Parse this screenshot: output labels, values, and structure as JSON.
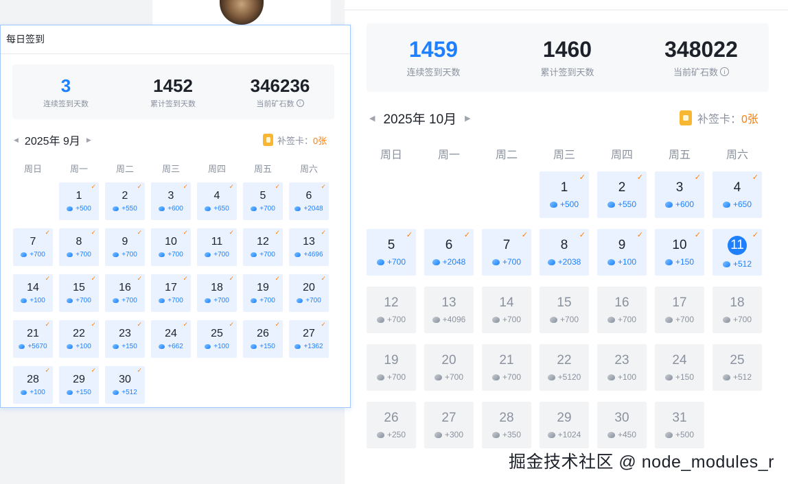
{
  "popup": {
    "title": "每日签到",
    "stats": [
      {
        "value": "3",
        "label": "连续签到天数",
        "highlight": true
      },
      {
        "value": "1452",
        "label": "累计签到天数",
        "highlight": false
      },
      {
        "value": "346236",
        "label": "当前矿石数",
        "highlight": false,
        "info": true
      }
    ],
    "month": "2025年 9月",
    "card_label": "补签卡：",
    "card_count": "0张",
    "weekdays": [
      "周日",
      "周一",
      "周二",
      "周三",
      "周四",
      "周五",
      "周六"
    ],
    "leading_empty": 1,
    "days": [
      {
        "d": "1",
        "p": "+500",
        "s": "done"
      },
      {
        "d": "2",
        "p": "+550",
        "s": "done"
      },
      {
        "d": "3",
        "p": "+600",
        "s": "done"
      },
      {
        "d": "4",
        "p": "+650",
        "s": "done"
      },
      {
        "d": "5",
        "p": "+700",
        "s": "done"
      },
      {
        "d": "6",
        "p": "+2048",
        "s": "done"
      },
      {
        "d": "7",
        "p": "+700",
        "s": "done"
      },
      {
        "d": "8",
        "p": "+700",
        "s": "done"
      },
      {
        "d": "9",
        "p": "+700",
        "s": "done"
      },
      {
        "d": "10",
        "p": "+700",
        "s": "done"
      },
      {
        "d": "11",
        "p": "+700",
        "s": "done"
      },
      {
        "d": "12",
        "p": "+700",
        "s": "done"
      },
      {
        "d": "13",
        "p": "+4696",
        "s": "done"
      },
      {
        "d": "14",
        "p": "+100",
        "s": "done"
      },
      {
        "d": "15",
        "p": "+700",
        "s": "done"
      },
      {
        "d": "16",
        "p": "+700",
        "s": "done"
      },
      {
        "d": "17",
        "p": "+700",
        "s": "done"
      },
      {
        "d": "18",
        "p": "+700",
        "s": "done"
      },
      {
        "d": "19",
        "p": "+700",
        "s": "done"
      },
      {
        "d": "20",
        "p": "+700",
        "s": "done"
      },
      {
        "d": "21",
        "p": "+5670",
        "s": "done"
      },
      {
        "d": "22",
        "p": "+100",
        "s": "done"
      },
      {
        "d": "23",
        "p": "+150",
        "s": "done"
      },
      {
        "d": "24",
        "p": "+662",
        "s": "done"
      },
      {
        "d": "25",
        "p": "+100",
        "s": "done"
      },
      {
        "d": "26",
        "p": "+150",
        "s": "done"
      },
      {
        "d": "27",
        "p": "+1362",
        "s": "done"
      },
      {
        "d": "28",
        "p": "+100",
        "s": "done"
      },
      {
        "d": "29",
        "p": "+150",
        "s": "done"
      },
      {
        "d": "30",
        "p": "+512",
        "s": "done"
      }
    ]
  },
  "main": {
    "stats": [
      {
        "value": "1459",
        "label": "连续签到天数",
        "highlight": true
      },
      {
        "value": "1460",
        "label": "累计签到天数",
        "highlight": false
      },
      {
        "value": "348022",
        "label": "当前矿石数",
        "highlight": false,
        "info": true
      }
    ],
    "month": "2025年 10月",
    "card_label": "补签卡：",
    "card_count": "0张",
    "weekdays": [
      "周日",
      "周一",
      "周二",
      "周三",
      "周四",
      "周五",
      "周六"
    ],
    "leading_empty": 3,
    "days": [
      {
        "d": "1",
        "p": "+500",
        "s": "done"
      },
      {
        "d": "2",
        "p": "+550",
        "s": "done"
      },
      {
        "d": "3",
        "p": "+600",
        "s": "done"
      },
      {
        "d": "4",
        "p": "+650",
        "s": "done"
      },
      {
        "d": "5",
        "p": "+700",
        "s": "done"
      },
      {
        "d": "6",
        "p": "+2048",
        "s": "done"
      },
      {
        "d": "7",
        "p": "+700",
        "s": "done"
      },
      {
        "d": "8",
        "p": "+2038",
        "s": "done"
      },
      {
        "d": "9",
        "p": "+100",
        "s": "done"
      },
      {
        "d": "10",
        "p": "+150",
        "s": "done"
      },
      {
        "d": "11",
        "p": "+512",
        "s": "today"
      },
      {
        "d": "12",
        "p": "+700",
        "s": "future"
      },
      {
        "d": "13",
        "p": "+4096",
        "s": "future"
      },
      {
        "d": "14",
        "p": "+700",
        "s": "future"
      },
      {
        "d": "15",
        "p": "+700",
        "s": "future"
      },
      {
        "d": "16",
        "p": "+700",
        "s": "future"
      },
      {
        "d": "17",
        "p": "+700",
        "s": "future"
      },
      {
        "d": "18",
        "p": "+700",
        "s": "future"
      },
      {
        "d": "19",
        "p": "+700",
        "s": "future"
      },
      {
        "d": "20",
        "p": "+700",
        "s": "future"
      },
      {
        "d": "21",
        "p": "+700",
        "s": "future"
      },
      {
        "d": "22",
        "p": "+5120",
        "s": "future"
      },
      {
        "d": "23",
        "p": "+100",
        "s": "future"
      },
      {
        "d": "24",
        "p": "+150",
        "s": "future"
      },
      {
        "d": "25",
        "p": "+512",
        "s": "future"
      },
      {
        "d": "26",
        "p": "+250",
        "s": "future"
      },
      {
        "d": "27",
        "p": "+300",
        "s": "future"
      },
      {
        "d": "28",
        "p": "+350",
        "s": "future"
      },
      {
        "d": "29",
        "p": "+1024",
        "s": "future"
      },
      {
        "d": "30",
        "p": "+450",
        "s": "future"
      },
      {
        "d": "31",
        "p": "+500",
        "s": "future"
      }
    ]
  },
  "watermark": "掘金技术社区 @ node_modules_r",
  "colors": {
    "accent": "#1e80ff",
    "check": "#ff7d00",
    "done_bg": "#eaf2ff",
    "future_bg": "#f2f3f5"
  }
}
